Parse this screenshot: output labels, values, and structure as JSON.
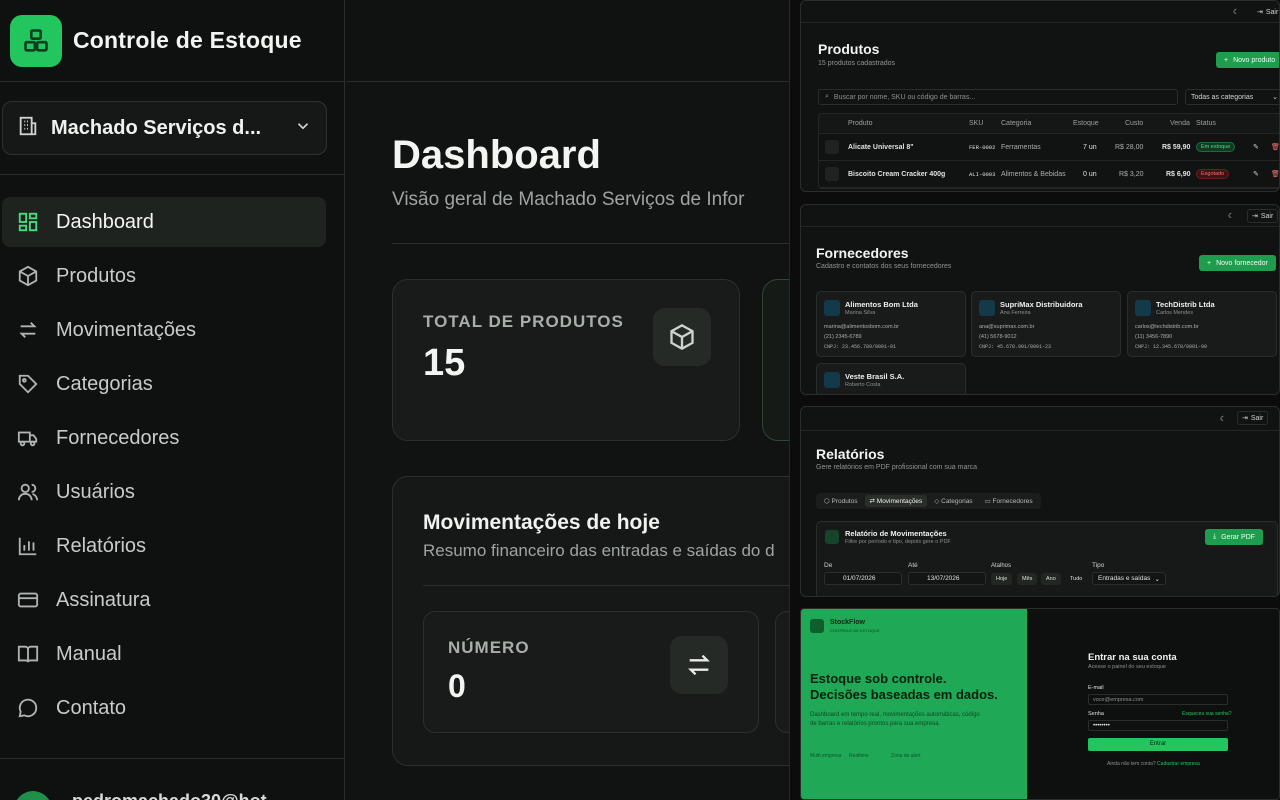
{
  "main": {
    "brand": {
      "title": "Controle de Estoque",
      "logo_icon": "boxes-icon"
    },
    "company": {
      "name": "Machado Serviços d..."
    },
    "nav": [
      {
        "label": "Dashboard",
        "icon": "grid-icon"
      },
      {
        "label": "Produtos",
        "icon": "box-icon"
      },
      {
        "label": "Movimentações",
        "icon": "arrows-icon"
      },
      {
        "label": "Categorias",
        "icon": "tag-icon"
      },
      {
        "label": "Fornecedores",
        "icon": "truck-icon"
      },
      {
        "label": "Usuários",
        "icon": "users-icon"
      },
      {
        "label": "Relatórios",
        "icon": "chart-icon"
      },
      {
        "label": "Assinatura",
        "icon": "card-icon"
      },
      {
        "label": "Manual",
        "icon": "book-icon"
      },
      {
        "label": "Contato",
        "icon": "chat-icon"
      }
    ],
    "user_email": "pedromachado30@hot",
    "page_title": "Dashboard",
    "page_subtitle": "Visão geral de Machado Serviços de Infor",
    "stat": {
      "label": "TOTAL DE PRODUTOS",
      "value": "15"
    },
    "movements": {
      "title": "Movimentações de hoje",
      "subtitle": "Resumo financeiro das entradas e saídas do d",
      "number_label": "NÚMERO",
      "number_value": "0"
    }
  },
  "products": {
    "logout": "Sair",
    "title": "Produtos",
    "subtitle": "15 produtos cadastrados",
    "new_button": "Novo produto",
    "search_placeholder": "Buscar por nome, SKU ou código de barras...",
    "category_select": "Todas as categorias",
    "columns": [
      "Produto",
      "SKU",
      "Categoria",
      "Estoque",
      "Custo",
      "Venda",
      "Status"
    ],
    "rows": [
      {
        "name": "Alicate Universal 8\"",
        "sku": "FER-0002",
        "category": "Ferramentas",
        "stock": "7 un",
        "cost": "R$ 28,00",
        "price": "R$ 59,90",
        "status": "Em estoque"
      },
      {
        "name": "Biscoito Cream Cracker 400g",
        "sku": "ALI-0003",
        "category": "Alimentos & Bebidas",
        "stock": "0 un",
        "cost": "R$ 3,20",
        "price": "R$ 6,90",
        "status": "Esgotado"
      }
    ]
  },
  "suppliers": {
    "logout": "Sair",
    "title": "Fornecedores",
    "subtitle": "Cadastro e contatos dos seus fornecedores",
    "new_button": "Novo fornecedor",
    "cards": [
      {
        "name": "Alimentos Bom Ltda",
        "person": "Marina Silva",
        "email": "marina@alimentosbom.com.br",
        "phone": "(21) 2345-6789",
        "cnpj": "CNPJ: 23.456.789/0001-01"
      },
      {
        "name": "SupriMax Distribuidora",
        "person": "Ana Ferreira",
        "email": "ana@suprimax.com.br",
        "phone": "(41) 5678-9012",
        "cnpj": "CNPJ: 45.678.901/0001-23"
      },
      {
        "name": "TechDistrib Ltda",
        "person": "Carlos Mendes",
        "email": "carlos@techdistrib.com.br",
        "phone": "(11) 3456-7890",
        "cnpj": "CNPJ: 12.345.678/0001-90"
      },
      {
        "name": "Veste Brasil S.A.",
        "person": "Roberto Costa"
      }
    ]
  },
  "reports": {
    "logout": "Sair",
    "title": "Relatórios",
    "subtitle": "Gere relatórios em PDF profissional com sua marca",
    "tabs": [
      "Produtos",
      "Movimentações",
      "Categorias",
      "Fornecedores"
    ],
    "card_title": "Relatório de Movimentações",
    "card_sub": "Filtre por período e tipo, depois gere o PDF",
    "generate": "Gerar PDF",
    "from_label": "De",
    "from_value": "01/07/2026",
    "to_label": "Até",
    "to_value": "13/07/2026",
    "shortcuts_label": "Atalhos",
    "shortcuts": [
      "Hoje",
      "Mês",
      "Ano",
      "Tudo"
    ],
    "type_label": "Tipo",
    "type_value": "Entradas e saídas"
  },
  "login": {
    "brand": "StockFlow",
    "brand_sub": "CONTROLE DE ESTOQUE",
    "headline1": "Estoque sob controle.",
    "headline2": "Decisões baseadas em dados.",
    "description": "Dashboard em tempo real, movimentações automáticas, código de barras e relatórios prontos para sua empresa.",
    "features": [
      "Multi empresa",
      "Realtime",
      "Zona de alert"
    ],
    "form_title": "Entrar na sua conta",
    "form_sub": "Acesse o painel do seu estoque",
    "email_label": "E-mail",
    "email_placeholder": "voce@empresa.com",
    "password_label": "Senha",
    "forgot": "Esqueceu sua senha?",
    "password_value": "••••••••",
    "submit": "Entrar",
    "no_account": "Ainda não tem conta?",
    "register": "Cadastrar empresa"
  }
}
